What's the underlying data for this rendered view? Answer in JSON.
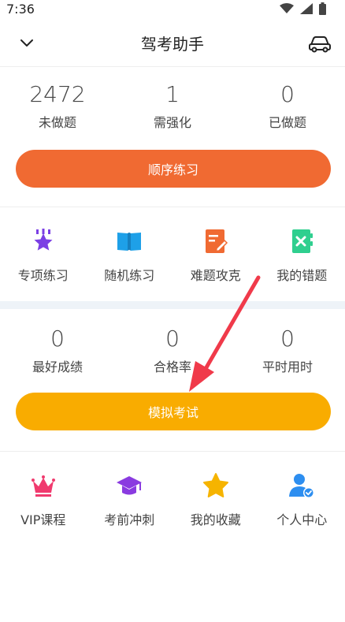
{
  "status": {
    "time": "7:36",
    "icons": [
      "wifi-icon",
      "signal-icon",
      "battery-icon"
    ]
  },
  "header": {
    "title": "驾考助手",
    "back_icon": "chevron-down-icon",
    "car_icon": "car-icon"
  },
  "practice": {
    "stats": [
      {
        "value": "2472",
        "label": "未做题"
      },
      {
        "value": "1",
        "label": "需强化"
      },
      {
        "value": "0",
        "label": "已做题"
      }
    ],
    "button_label": "顺序练习",
    "grid": [
      {
        "label": "专项练习",
        "icon": "star-stack-icon",
        "color": "#7b3fe4"
      },
      {
        "label": "随机练习",
        "icon": "book-icon",
        "color": "#1ea0e8"
      },
      {
        "label": "难题攻克",
        "icon": "edit-note-icon",
        "color": "#f06a32"
      },
      {
        "label": "我的错题",
        "icon": "wrong-note-icon",
        "color": "#2fcf8f"
      }
    ]
  },
  "exam": {
    "stats": [
      {
        "value": "0",
        "label": "最好成绩"
      },
      {
        "value": "0",
        "label": "合格率"
      },
      {
        "value": "0",
        "label": "平时用时"
      }
    ],
    "button_label": "模拟考试"
  },
  "more": {
    "grid": [
      {
        "label": "VIP课程",
        "icon": "crown-icon",
        "color": "#f03a6e"
      },
      {
        "label": "考前冲刺",
        "icon": "graduation-cap-icon",
        "color": "#8a3be0"
      },
      {
        "label": "我的收藏",
        "icon": "star-icon",
        "color": "#f6b400"
      },
      {
        "label": "个人中心",
        "icon": "user-icon",
        "color": "#2d8ef0"
      }
    ]
  },
  "colors": {
    "orange": "#f06a32",
    "yellow": "#f9ac00",
    "arrow": "#f03a4a"
  }
}
